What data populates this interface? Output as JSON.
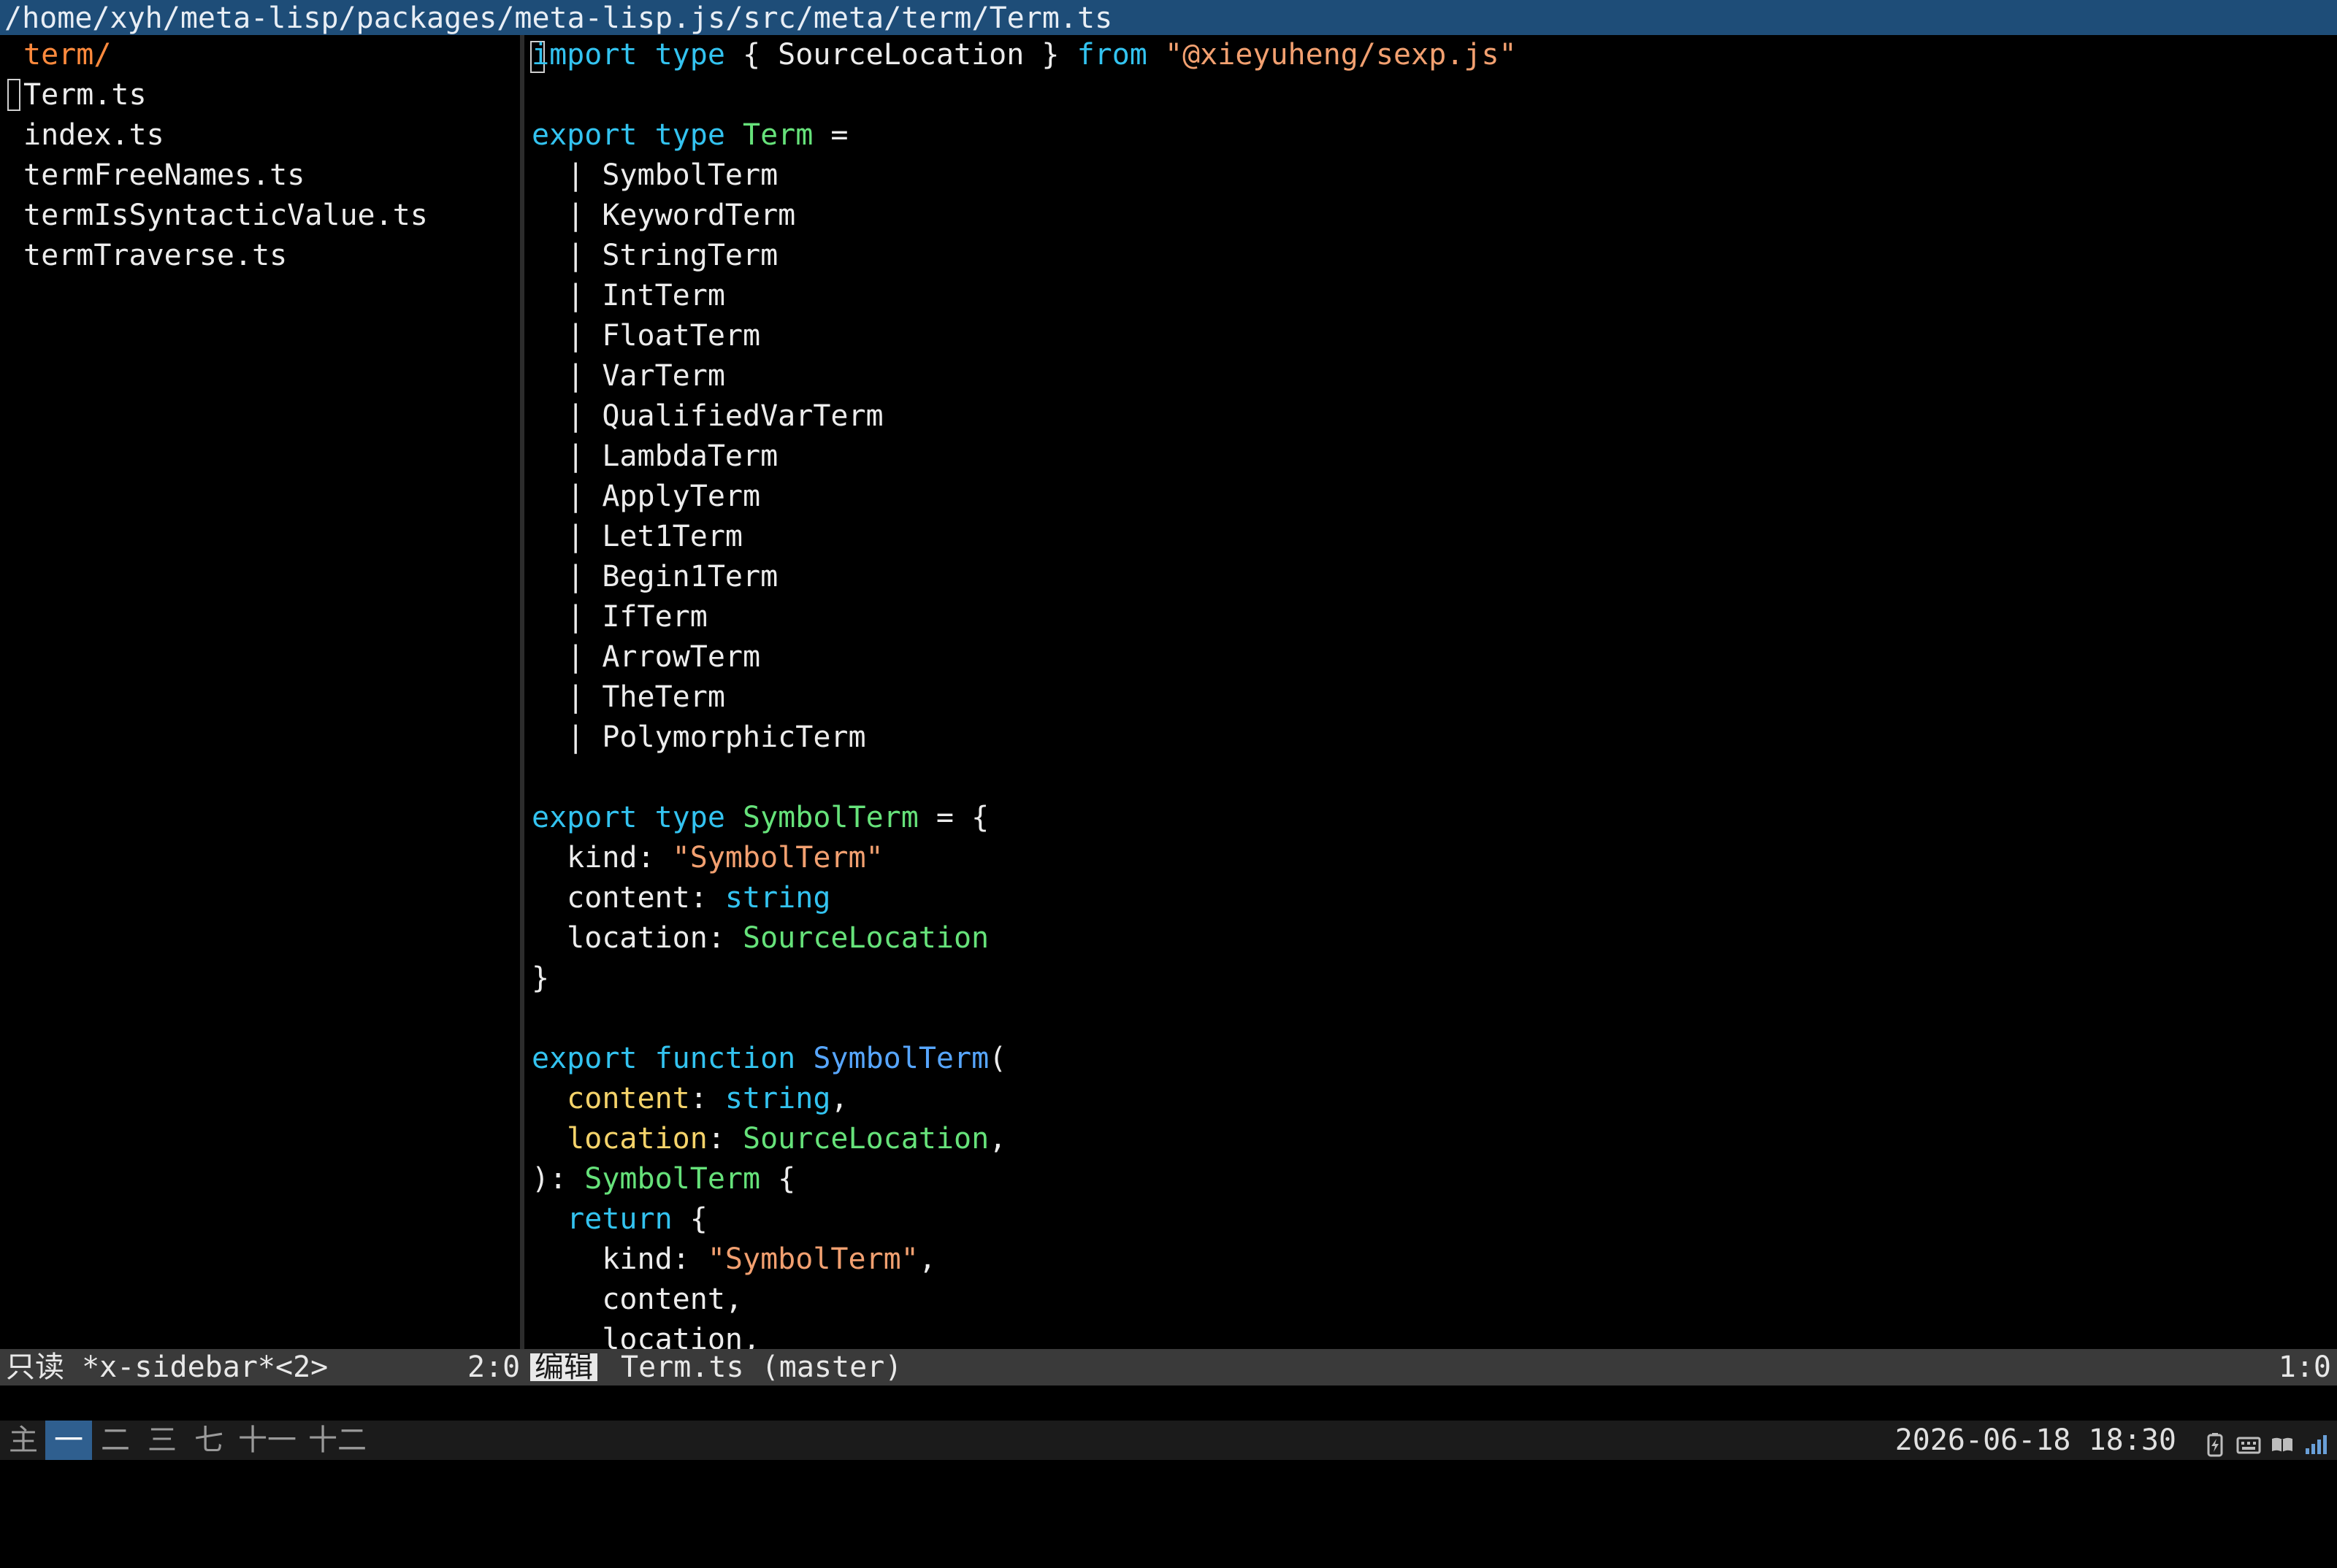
{
  "titlebar": {
    "path": "/home/xyh/meta-lisp/packages/meta-lisp.js/src/meta/term/Term.ts"
  },
  "sidebar": {
    "directory": "term/",
    "files": [
      "Term.ts",
      "index.ts",
      "termFreeNames.ts",
      "termIsSyntacticValue.ts",
      "termTraverse.ts"
    ]
  },
  "editor": {
    "lines": [
      [
        {
          "t": "import",
          "c": "kw"
        },
        {
          "t": " ",
          "c": "plain"
        },
        {
          "t": "type",
          "c": "kw"
        },
        {
          "t": " { SourceLocation } ",
          "c": "plain"
        },
        {
          "t": "from",
          "c": "kw"
        },
        {
          "t": " ",
          "c": "plain"
        },
        {
          "t": "\"@xieyuheng/sexp.js\"",
          "c": "st"
        }
      ],
      [],
      [
        {
          "t": "export",
          "c": "kw"
        },
        {
          "t": " ",
          "c": "plain"
        },
        {
          "t": "type",
          "c": "kw"
        },
        {
          "t": " ",
          "c": "plain"
        },
        {
          "t": "Term",
          "c": "ty"
        },
        {
          "t": " =",
          "c": "plain"
        }
      ],
      [
        {
          "t": "  | SymbolTerm",
          "c": "plain"
        }
      ],
      [
        {
          "t": "  | KeywordTerm",
          "c": "plain"
        }
      ],
      [
        {
          "t": "  | StringTerm",
          "c": "plain"
        }
      ],
      [
        {
          "t": "  | IntTerm",
          "c": "plain"
        }
      ],
      [
        {
          "t": "  | FloatTerm",
          "c": "plain"
        }
      ],
      [
        {
          "t": "  | VarTerm",
          "c": "plain"
        }
      ],
      [
        {
          "t": "  | QualifiedVarTerm",
          "c": "plain"
        }
      ],
      [
        {
          "t": "  | LambdaTerm",
          "c": "plain"
        }
      ],
      [
        {
          "t": "  | ApplyTerm",
          "c": "plain"
        }
      ],
      [
        {
          "t": "  | Let1Term",
          "c": "plain"
        }
      ],
      [
        {
          "t": "  | Begin1Term",
          "c": "plain"
        }
      ],
      [
        {
          "t": "  | IfTerm",
          "c": "plain"
        }
      ],
      [
        {
          "t": "  | ArrowTerm",
          "c": "plain"
        }
      ],
      [
        {
          "t": "  | TheTerm",
          "c": "plain"
        }
      ],
      [
        {
          "t": "  | PolymorphicTerm",
          "c": "plain"
        }
      ],
      [],
      [
        {
          "t": "export",
          "c": "kw"
        },
        {
          "t": " ",
          "c": "plain"
        },
        {
          "t": "type",
          "c": "kw"
        },
        {
          "t": " ",
          "c": "plain"
        },
        {
          "t": "SymbolTerm",
          "c": "ty"
        },
        {
          "t": " = {",
          "c": "plain"
        }
      ],
      [
        {
          "t": "  kind: ",
          "c": "plain"
        },
        {
          "t": "\"SymbolTerm\"",
          "c": "st"
        }
      ],
      [
        {
          "t": "  content: ",
          "c": "plain"
        },
        {
          "t": "string",
          "c": "kw"
        }
      ],
      [
        {
          "t": "  location: ",
          "c": "plain"
        },
        {
          "t": "SourceLocation",
          "c": "ty"
        }
      ],
      [
        {
          "t": "}",
          "c": "plain"
        }
      ],
      [],
      [
        {
          "t": "export",
          "c": "kw"
        },
        {
          "t": " ",
          "c": "plain"
        },
        {
          "t": "function",
          "c": "kw"
        },
        {
          "t": " ",
          "c": "plain"
        },
        {
          "t": "SymbolTerm",
          "c": "fn"
        },
        {
          "t": "(",
          "c": "plain"
        }
      ],
      [
        {
          "t": "  ",
          "c": "plain"
        },
        {
          "t": "content",
          "c": "id"
        },
        {
          "t": ": ",
          "c": "plain"
        },
        {
          "t": "string",
          "c": "kw"
        },
        {
          "t": ",",
          "c": "plain"
        }
      ],
      [
        {
          "t": "  ",
          "c": "plain"
        },
        {
          "t": "location",
          "c": "id"
        },
        {
          "t": ": ",
          "c": "plain"
        },
        {
          "t": "SourceLocation",
          "c": "ty"
        },
        {
          "t": ",",
          "c": "plain"
        }
      ],
      [
        {
          "t": "): ",
          "c": "plain"
        },
        {
          "t": "SymbolTerm",
          "c": "ty"
        },
        {
          "t": " {",
          "c": "plain"
        }
      ],
      [
        {
          "t": "  ",
          "c": "plain"
        },
        {
          "t": "return",
          "c": "kw"
        },
        {
          "t": " {",
          "c": "plain"
        }
      ],
      [
        {
          "t": "    kind: ",
          "c": "plain"
        },
        {
          "t": "\"SymbolTerm\"",
          "c": "st"
        },
        {
          "t": ",",
          "c": "plain"
        }
      ],
      [
        {
          "t": "    content,",
          "c": "plain"
        }
      ],
      [
        {
          "t": "    location,",
          "c": "plain"
        }
      ]
    ]
  },
  "modeline": {
    "left_status": "只读 *x-sidebar*<2>",
    "left_pos": "2:0",
    "badge": "编辑",
    "buffer": "Term.ts (master)",
    "right_pos": "1:0"
  },
  "taskbar": {
    "workspaces": [
      "主",
      "一",
      "二",
      "三",
      "七",
      "十一",
      "十二"
    ],
    "active_workspace": "一",
    "clock": "2026-06-18 18:30",
    "tray_icons": [
      "battery-charging-icon",
      "keyboard-icon",
      "book-icon",
      "signal-icon"
    ]
  }
}
